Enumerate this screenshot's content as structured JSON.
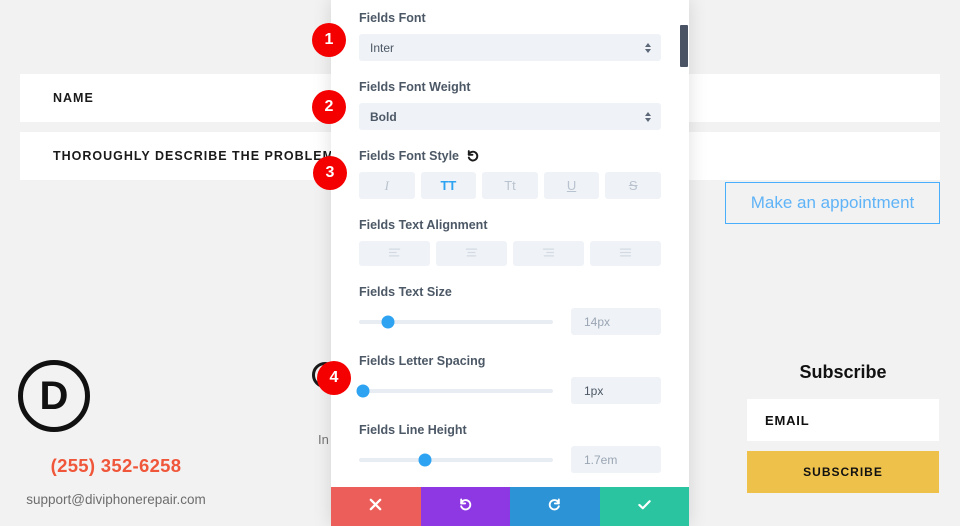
{
  "background": {
    "fields": [
      {
        "label": "NAME"
      },
      {
        "label": "THOROUGHLY DESCRIBE THE PROBLEM"
      }
    ],
    "appointment_button": "Make an appointment",
    "logo_letter": "D",
    "phone": "(255) 352-6258",
    "email": "support@diviphonerepair.com",
    "occluded_text": "In",
    "subscribe": {
      "title": "Subscribe",
      "email_placeholder": "EMAIL",
      "button": "SUBSCRIBE"
    },
    "colors": {
      "page_bg": "#f2f2f2",
      "field_bg": "#ffffff",
      "appointment_border": "#49aefb",
      "appointment_text": "#5fb3f7",
      "phone": "#f0563a",
      "subscribe_button": "#eec14a"
    }
  },
  "panel": {
    "controls": [
      {
        "label": "Fields Font",
        "type": "select",
        "value": "Inter"
      },
      {
        "label": "Fields Font Weight",
        "type": "select",
        "value": "Bold"
      },
      {
        "label": "Fields Font Style",
        "type": "style-buttons",
        "reset_icon": "reset-icon",
        "buttons": [
          {
            "name": "italic",
            "glyph": "I",
            "active": false
          },
          {
            "name": "uppercase",
            "glyph": "TT",
            "active": true
          },
          {
            "name": "small-caps",
            "glyph": "Tt",
            "active": false
          },
          {
            "name": "underline",
            "glyph": "U",
            "active": false
          },
          {
            "name": "strikethrough",
            "glyph": "S",
            "active": false
          }
        ]
      },
      {
        "label": "Fields Text Alignment",
        "type": "align-buttons",
        "buttons": [
          {
            "name": "align-left",
            "active": false
          },
          {
            "name": "align-center",
            "active": false
          },
          {
            "name": "align-right",
            "active": false
          },
          {
            "name": "align-justify",
            "active": false
          }
        ]
      },
      {
        "label": "Fields Text Size",
        "type": "slider",
        "value": "14px",
        "value_state": "placeholder",
        "thumb_percent": 15
      },
      {
        "label": "Fields Letter Spacing",
        "type": "slider",
        "value": "1px",
        "value_state": "set",
        "thumb_percent": 2
      },
      {
        "label": "Fields Line Height",
        "type": "slider",
        "value": "1.7em",
        "value_state": "placeholder",
        "thumb_percent": 34
      }
    ],
    "actions": [
      {
        "name": "cancel",
        "icon": "close-icon",
        "color": "#eb5e5a"
      },
      {
        "name": "undo",
        "icon": "undo-icon",
        "color": "#8e38e4"
      },
      {
        "name": "redo",
        "icon": "redo-icon",
        "color": "#2b93d6"
      },
      {
        "name": "save",
        "icon": "checkmark-icon",
        "color": "#2bc4a0"
      }
    ],
    "accent_color": "#2ea3f2"
  },
  "badges": [
    {
      "number": "1"
    },
    {
      "number": "2"
    },
    {
      "number": "3"
    },
    {
      "number": "4"
    }
  ]
}
